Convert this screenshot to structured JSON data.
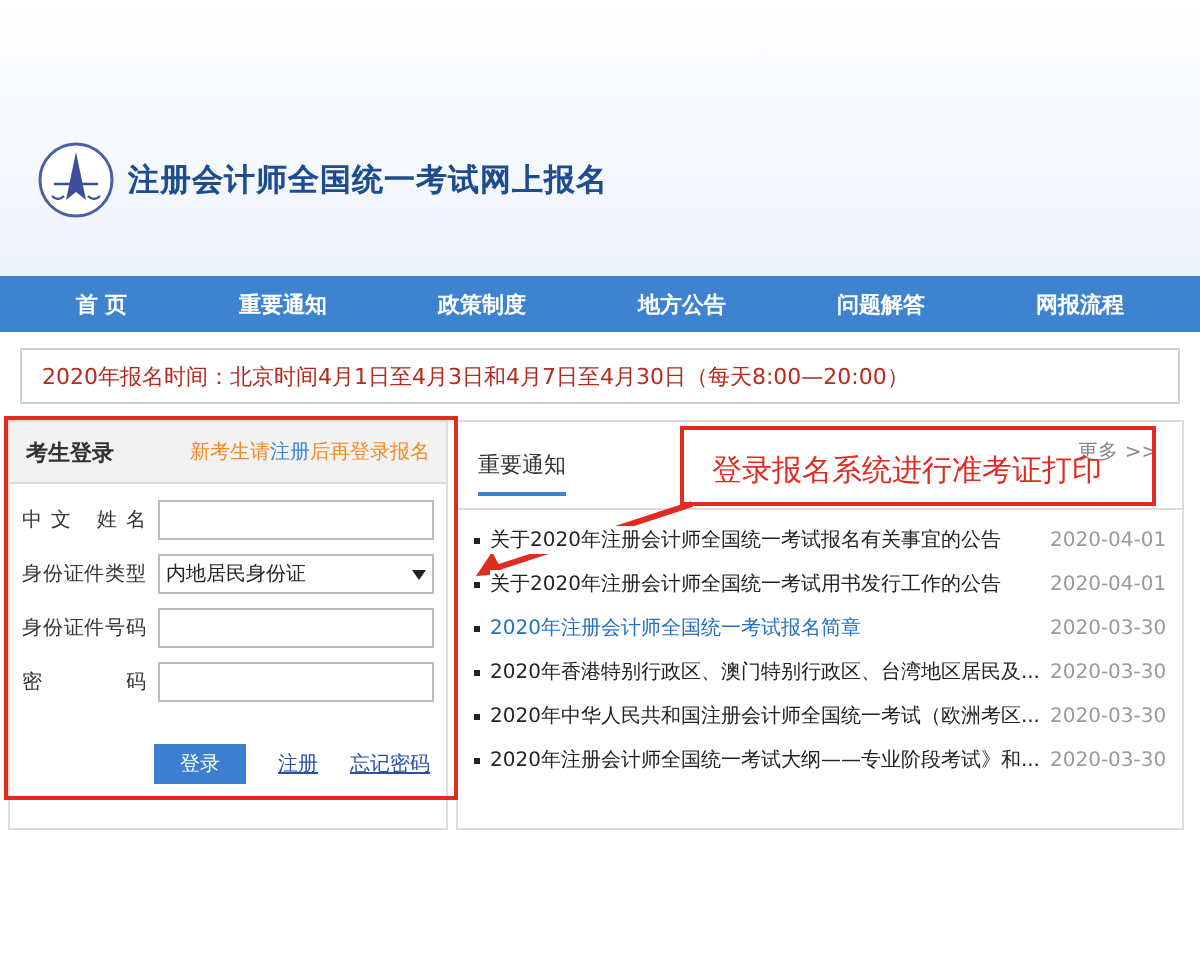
{
  "header": {
    "title": "注册会计师全国统一考试网上报名"
  },
  "nav": [
    {
      "label": "首 页"
    },
    {
      "label": "重要通知"
    },
    {
      "label": "政策制度"
    },
    {
      "label": "地方公告"
    },
    {
      "label": "问题解答"
    },
    {
      "label": "网报流程"
    }
  ],
  "notice_bar": {
    "text": "2020年报名时间：北京时间4月1日至4月3日和4月7日至4月30日（每天8:00—20:00）"
  },
  "login": {
    "title": "考生登录",
    "hint_before": "新考生请",
    "hint_link": "注册",
    "hint_after": "后再登录报名",
    "fields": [
      {
        "label": "中文 姓名",
        "kind": "text"
      },
      {
        "label": "身份证件类型",
        "kind": "select",
        "value": "内地居民身份证"
      },
      {
        "label": "身份证件号码",
        "kind": "text"
      },
      {
        "label": "密 码",
        "kind": "password"
      }
    ],
    "submit": "登录",
    "links": [
      "注册",
      "忘记密码"
    ]
  },
  "news": {
    "title": "重要通知",
    "more": "更多 >>",
    "items": [
      {
        "text": "关于2020年注册会计师全国统一考试报名有关事宜的公告",
        "date": "2020-04-01",
        "highlighted": false
      },
      {
        "text": "关于2020年注册会计师全国统一考试用书发行工作的公告",
        "date": "2020-04-01",
        "highlighted": false
      },
      {
        "text": "2020年注册会计师全国统一考试报名简章",
        "date": "2020-03-30",
        "highlighted": true
      },
      {
        "text": "2020年香港特别行政区、澳门特别行政区、台湾地区居民及...",
        "date": "2020-03-30",
        "highlighted": false
      },
      {
        "text": "2020年中华人民共和国注册会计师全国统一考试（欧洲考区...",
        "date": "2020-03-30",
        "highlighted": false
      },
      {
        "text": "2020年注册会计师全国统一考试大纲——专业阶段考试》和...",
        "date": "2020-03-30",
        "highlighted": false
      }
    ]
  },
  "annotation": {
    "text": "登录报名系统进行准考证打印"
  }
}
